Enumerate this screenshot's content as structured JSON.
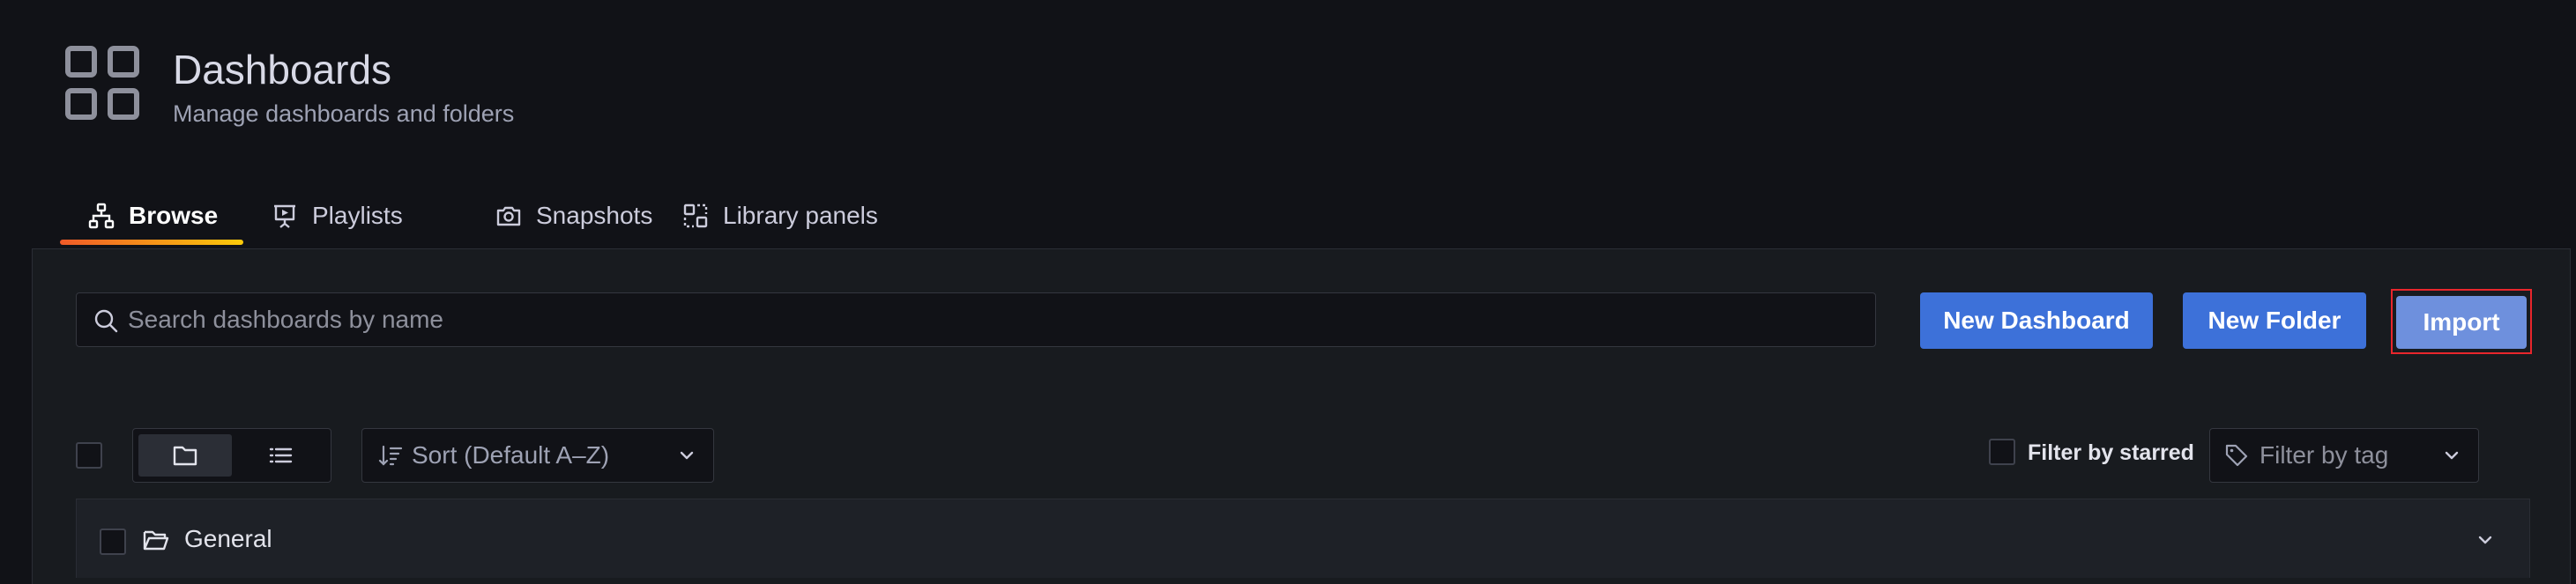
{
  "page": {
    "title": "Dashboards",
    "subtitle": "Manage dashboards and folders",
    "icon": "apps-grid-icon"
  },
  "tabs": [
    {
      "label": "Browse",
      "icon": "sitemap-icon",
      "active": true
    },
    {
      "label": "Playlists",
      "icon": "presentation-icon",
      "active": false
    },
    {
      "label": "Snapshots",
      "icon": "camera-icon",
      "active": false
    },
    {
      "label": "Library panels",
      "icon": "library-panel-icon",
      "active": false
    }
  ],
  "search": {
    "placeholder": "Search dashboards by name",
    "value": ""
  },
  "actions": {
    "new_dashboard": "New Dashboard",
    "new_folder": "New Folder",
    "import": "Import"
  },
  "toolbar": {
    "view_modes": [
      "folder-view",
      "list-view"
    ],
    "selected_view": "folder-view",
    "sort_label": "Sort (Default A–Z)",
    "filter_starred_label": "Filter by starred",
    "filter_tag_placeholder": "Filter by tag"
  },
  "folders": [
    {
      "name": "General",
      "expanded": false
    }
  ],
  "colors": {
    "background": "#111217",
    "panel": "#181b1f",
    "primary_button": "#3d71d9",
    "import_button": "#6e90dd",
    "highlight_outline": "#e8262c",
    "tab_underline_start": "#f05a28",
    "tab_underline_end": "#fbca0a"
  }
}
